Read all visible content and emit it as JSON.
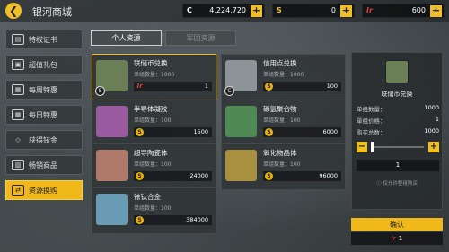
{
  "header": {
    "back_icon": "back-arrow-icon",
    "title": "银河商城"
  },
  "currencies": [
    {
      "icon": "C",
      "value": "4,224,720"
    },
    {
      "icon": "S",
      "value": "0"
    },
    {
      "icon": "Ir",
      "value": "600"
    }
  ],
  "sidebar": {
    "items": [
      {
        "label": "特权证书",
        "icon": "certificate-icon",
        "active": false
      },
      {
        "label": "超值礼包",
        "icon": "gift-icon",
        "active": false
      },
      {
        "label": "每周特惠",
        "icon": "calendar-icon",
        "active": false
      },
      {
        "label": "每日特惠",
        "icon": "calendar-icon",
        "active": false
      },
      {
        "label": "获得铱金",
        "icon": "diamond-icon",
        "active": false
      },
      {
        "label": "畅销商品",
        "icon": "bag-icon",
        "active": false
      },
      {
        "label": "资源换购",
        "icon": "exchange-icon",
        "active": true
      }
    ]
  },
  "tabs": [
    {
      "label": "个人资源",
      "active": true
    },
    {
      "label": "军团资源",
      "active": false
    }
  ],
  "qty_label": "单组数量：",
  "items": [
    {
      "name": "联储币兑换",
      "qty": "1000",
      "price_icon": "Ir",
      "price": "1",
      "badge": "S",
      "color": "#6b7f56",
      "selected": true
    },
    {
      "name": "信用点兑换",
      "qty": "1000",
      "price_icon": "S",
      "price": "100",
      "badge": "C",
      "color": "#8d9396",
      "selected": false
    },
    {
      "name": "半导体凝胶",
      "qty": "100",
      "price_icon": "S",
      "price": "1500",
      "badge": "",
      "color": "#9a5aa0",
      "selected": false
    },
    {
      "name": "碳氢聚合物",
      "qty": "100",
      "price_icon": "S",
      "price": "6000",
      "badge": "",
      "color": "#4f8a55",
      "selected": false
    },
    {
      "name": "超导陶瓷体",
      "qty": "100",
      "price_icon": "S",
      "price": "24000",
      "badge": "",
      "color": "#b07a6a",
      "selected": false
    },
    {
      "name": "氧化物晶体",
      "qty": "100",
      "price_icon": "S",
      "price": "96000",
      "badge": "",
      "color": "#a89040",
      "selected": false
    },
    {
      "name": "铱钛合金",
      "qty": "100",
      "price_icon": "S",
      "price": "384000",
      "badge": "",
      "color": "#6a9bb5",
      "selected": false
    }
  ],
  "panel": {
    "title": "联储币兑换",
    "rows": [
      {
        "label": "单组数量：",
        "value": "1000"
      },
      {
        "label": "单组价格：",
        "value": "1"
      },
      {
        "label": "购买总数：",
        "value": "1000"
      }
    ],
    "quantity": "1",
    "note": "仅允许整组购买",
    "confirm": "确认",
    "total": "1"
  }
}
